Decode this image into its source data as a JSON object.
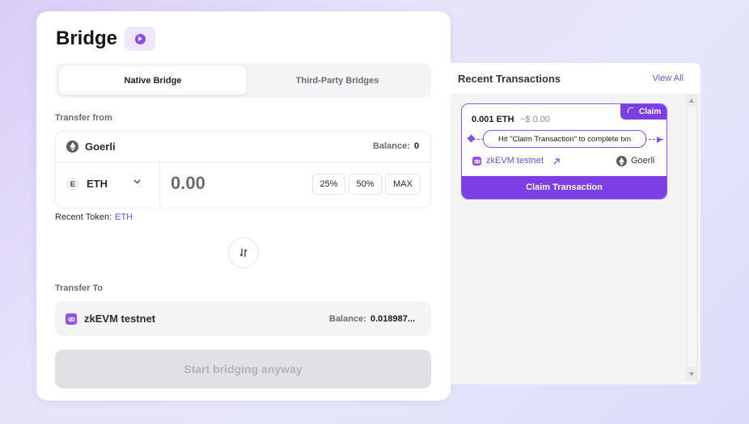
{
  "bridge": {
    "title": "Bridge",
    "tabs": [
      {
        "label": "Native Bridge",
        "active": true
      },
      {
        "label": "Third-Party Bridges",
        "active": false
      }
    ],
    "transfer_from": {
      "label": "Transfer from",
      "network": "Goerli",
      "balance_label": "Balance:",
      "balance_value": "0",
      "token": "ETH",
      "token_badge": "E",
      "amount_placeholder": "0.00",
      "pct_buttons": [
        "25%",
        "50%",
        "MAX"
      ]
    },
    "recent_token": {
      "label": "Recent Token:",
      "token": "ETH"
    },
    "transfer_to": {
      "label": "Transfer To",
      "network": "zkEVM testnet",
      "balance_label": "Balance:",
      "balance_value": "0.018987..."
    },
    "start_button": "Start bridging anyway"
  },
  "recent": {
    "title": "Recent Transactions",
    "view_all": "View All",
    "transactions": [
      {
        "amount": "0.001 ETH",
        "usd": "~$ 0.00",
        "status": "Claim",
        "hint": "Hit \"Claim Transaction\" to complete txn",
        "from_network": "zkEVM testnet",
        "to_network": "Goerli",
        "action": "Claim Transaction"
      }
    ]
  },
  "colors": {
    "accent": "#7b3fe4",
    "link": "#6a4ef0",
    "disabled_button": "#e1e1e5"
  }
}
